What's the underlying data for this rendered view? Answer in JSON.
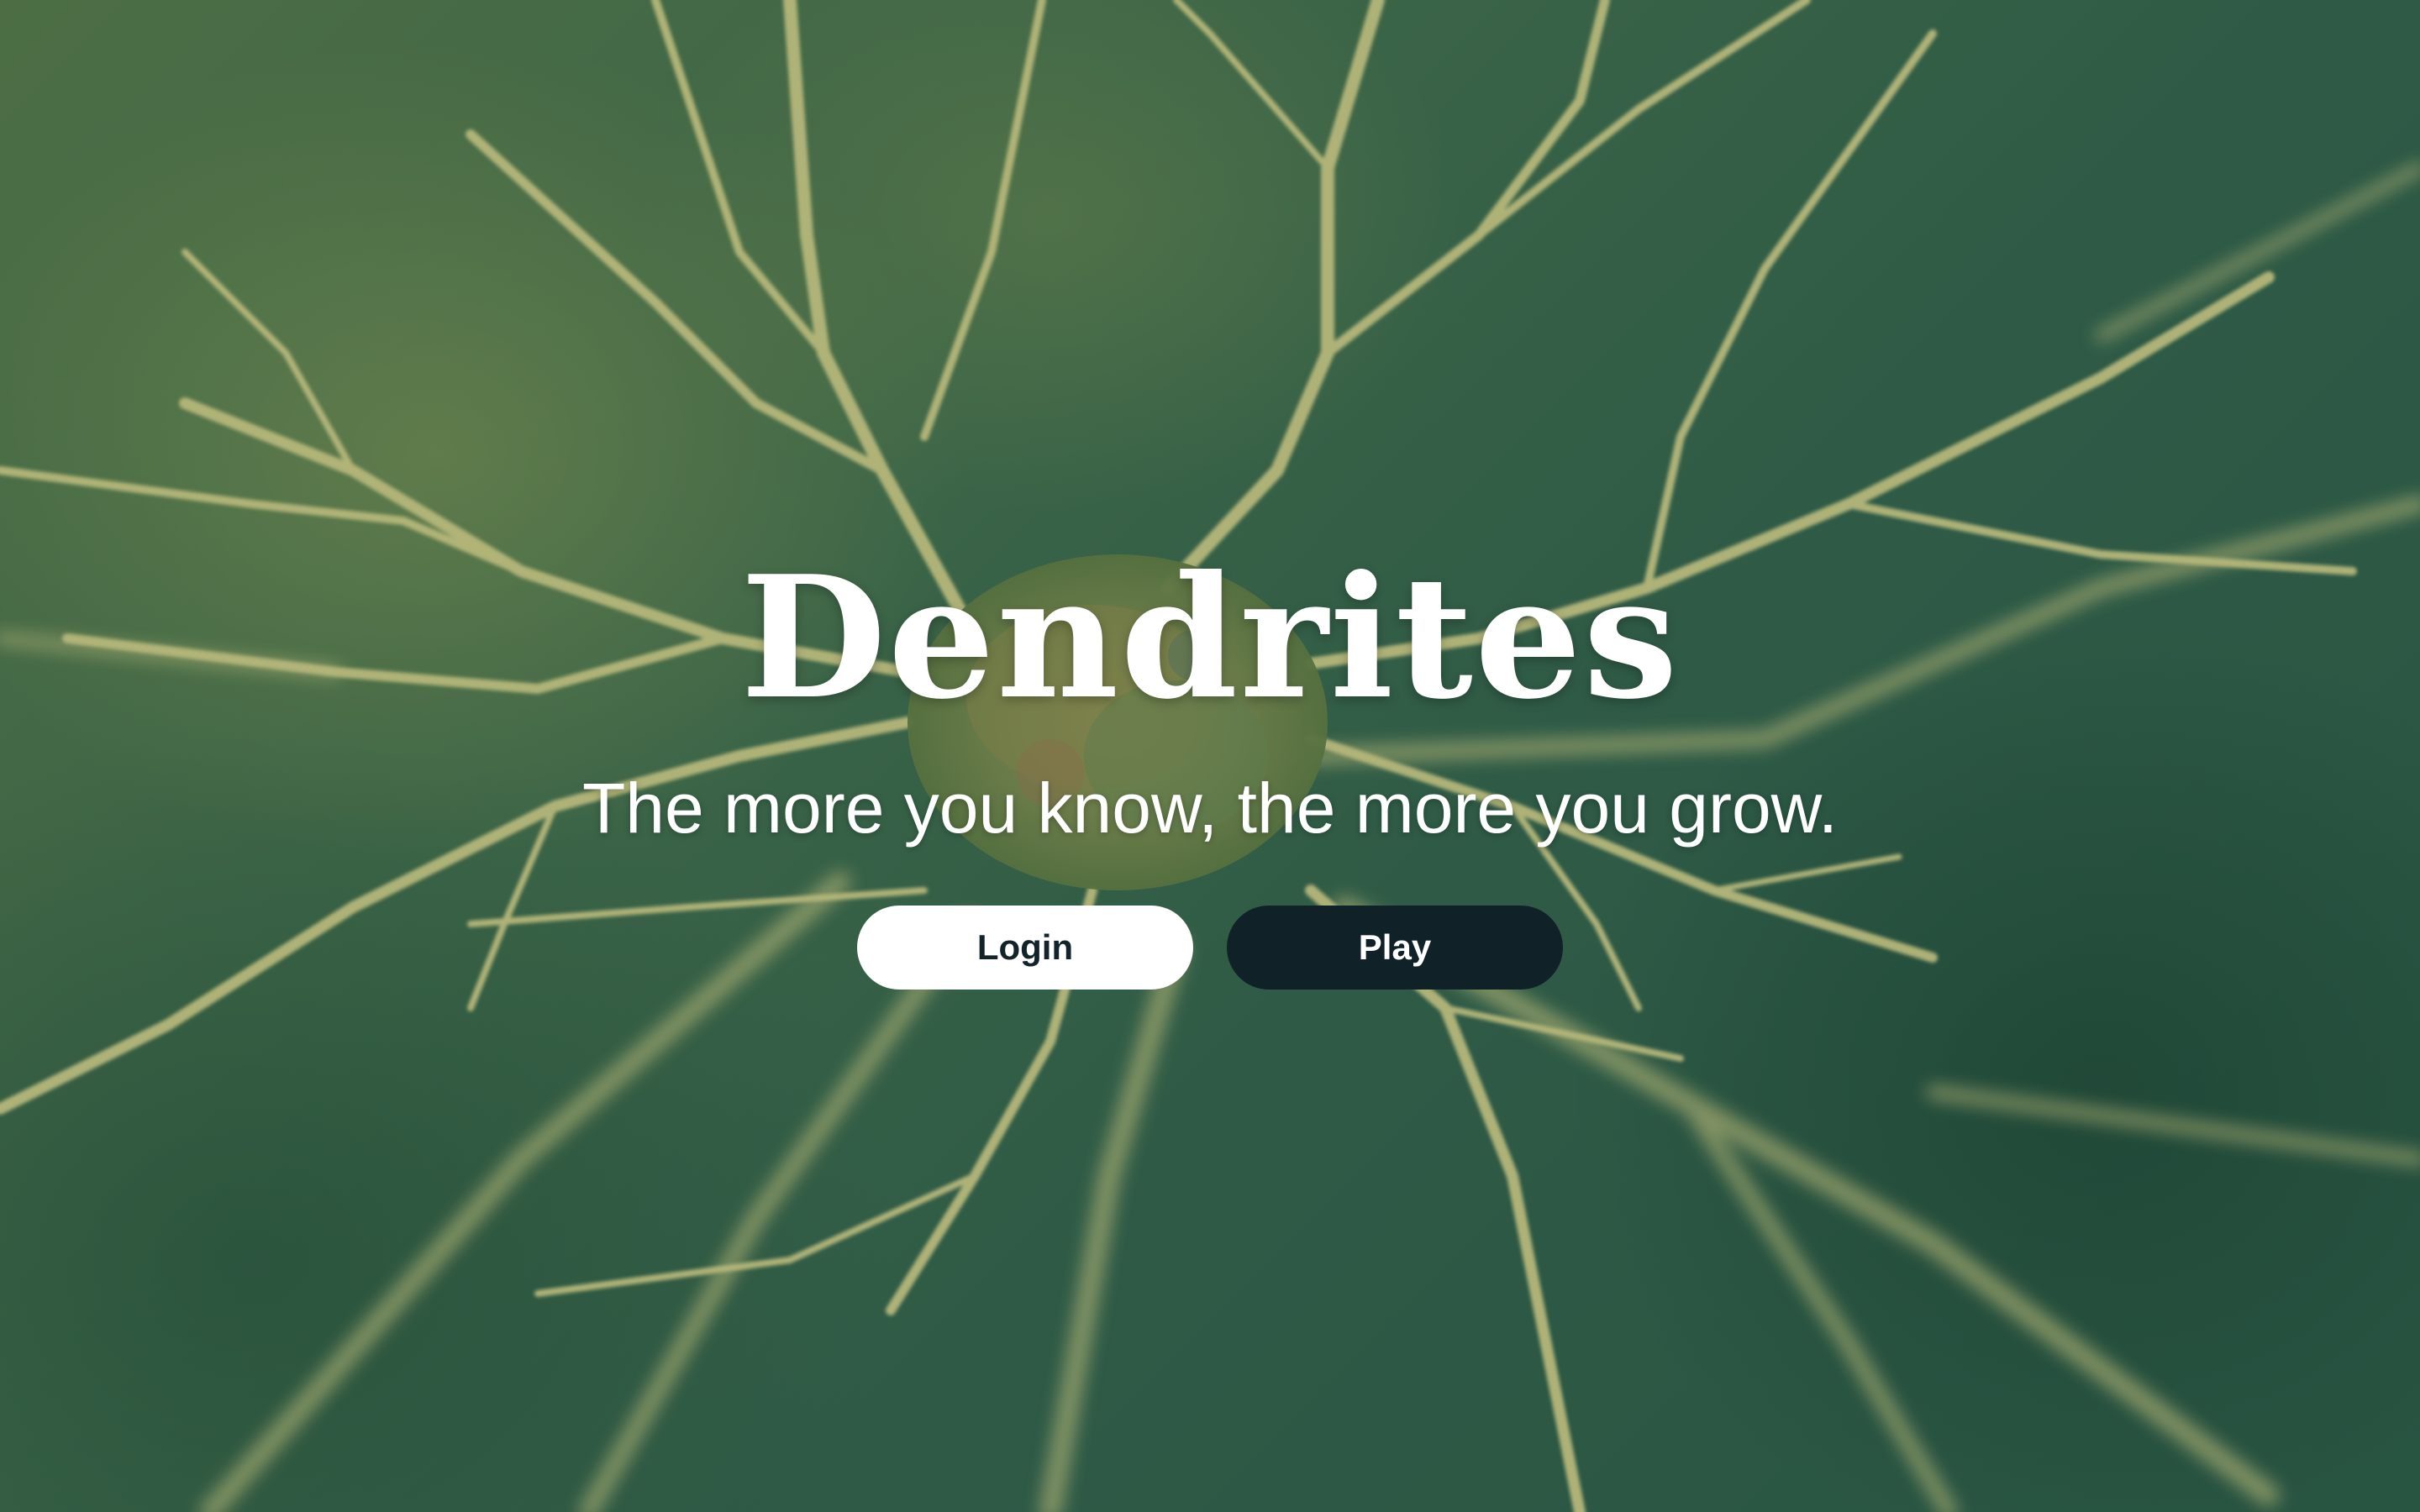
{
  "app": {
    "title": "Dendrites",
    "tagline": "The more you know, the more you grow."
  },
  "actions": {
    "login_label": "Login",
    "play_label": "Play"
  },
  "background": {
    "image": "neuron-dendrites-illustration",
    "base_color": "#2c5a44"
  },
  "colors": {
    "login_bg": "#ffffff",
    "login_text": "#12232a",
    "play_bg": "#102227",
    "play_text": "#ffffff"
  }
}
